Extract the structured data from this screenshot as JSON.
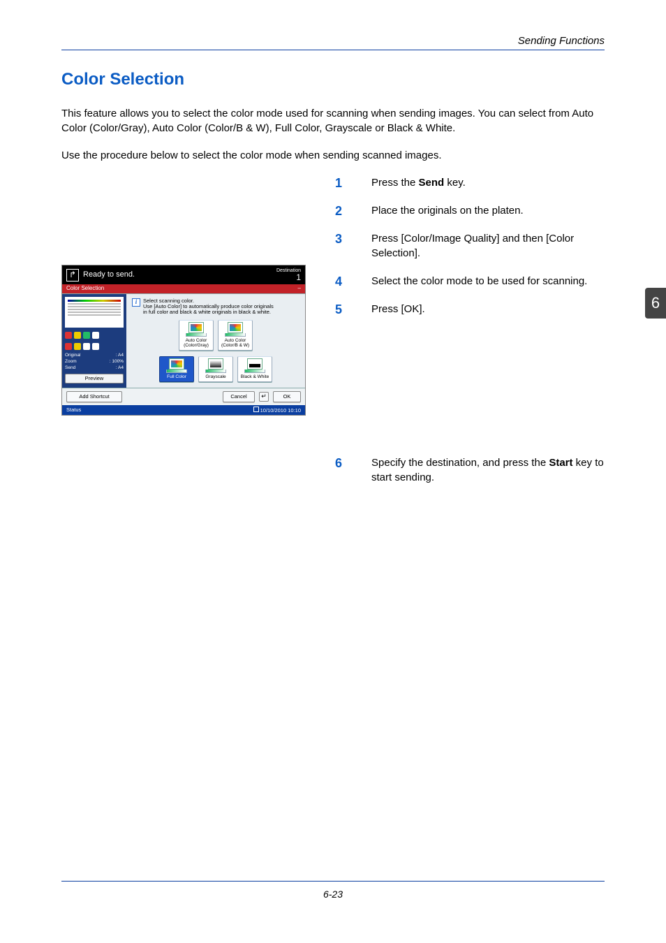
{
  "header": {
    "label": "Sending Functions"
  },
  "title": "Color Selection",
  "intro1": "This feature allows you to select the color mode used for scanning when sending images. You can select from Auto Color (Color/Gray), Auto Color (Color/B & W), Full Color, Grayscale or Black & White.",
  "intro2": "Use the procedure below to select the color mode when sending scanned images.",
  "steps": {
    "s1_a": "Press the ",
    "s1_b": "Send",
    "s1_c": " key.",
    "s2": "Place the originals on the platen.",
    "s3": "Press [Color/Image Quality] and then [Color Selection].",
    "s4": "Select the color mode to be used for scanning.",
    "s5": "Press [OK].",
    "s6_a": "Specify the destination, and press the ",
    "s6_b": "Start",
    "s6_c": " key to start sending."
  },
  "side_tab": "6",
  "footer": "6-23",
  "panel": {
    "top_title": "Ready to send.",
    "top_dest_label": "Destination",
    "top_dest_count": "1",
    "redbar_title": "Color Selection",
    "info_line1": "Select scanning color.",
    "info_line2": "Use [Auto Color] to automatically produce color originals",
    "info_line3": "in full color and black & white originals in black & white.",
    "preview": {
      "original_lbl": "Original",
      "original_val": ": A4",
      "zoom_lbl": "Zoom",
      "zoom_val": ": 100%",
      "send_lbl": "Send",
      "send_val": ": A4",
      "preview_btn": "Preview"
    },
    "options": {
      "o1": "Auto Color (Color/Gray)",
      "o2": "Auto Color (Color/B & W)",
      "o3": "Full Color",
      "o4": "Grayscale",
      "o5": "Black & White"
    },
    "add_shortcut": "Add Shortcut",
    "cancel": "Cancel",
    "ok": "OK",
    "status_label": "Status",
    "status_time": "10/10/2010  10:10"
  }
}
